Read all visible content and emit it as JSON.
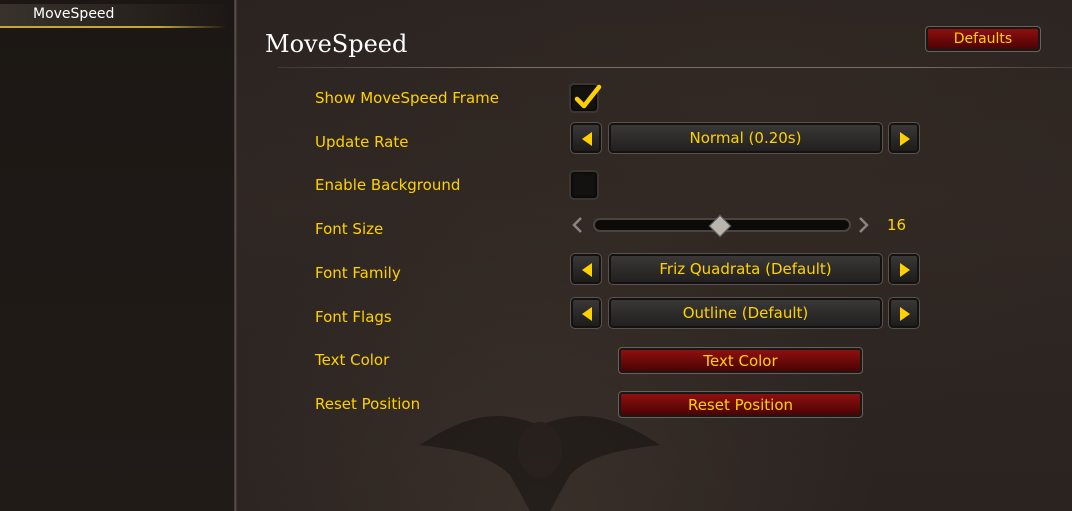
{
  "sidebar": {
    "items": [
      {
        "label": "MoveSpeed",
        "selected": true
      }
    ]
  },
  "header": {
    "title": "MoveSpeed",
    "defaults_label": "Defaults"
  },
  "settings": {
    "show_frame": {
      "label": "Show MoveSpeed Frame",
      "checked": true
    },
    "update_rate": {
      "label": "Update Rate",
      "value": "Normal (0.20s)"
    },
    "enable_background": {
      "label": "Enable Background",
      "checked": false
    },
    "font_size": {
      "label": "Font Size",
      "value": "16",
      "slider_fraction": 0.49
    },
    "font_family": {
      "label": "Font Family",
      "value": "Friz Quadrata (Default)"
    },
    "font_flags": {
      "label": "Font Flags",
      "value": "Outline (Default)"
    },
    "text_color": {
      "label": "Text Color",
      "button_label": "Text Color"
    },
    "reset_position": {
      "label": "Reset Position",
      "button_label": "Reset Position"
    }
  },
  "colors": {
    "accent_gold": "#ffd100",
    "button_red": "#7a0a0a",
    "background": "#2a2320"
  },
  "icons": {
    "checkmark": "check-icon",
    "left": "arrow-left-icon",
    "right": "arrow-right-icon"
  }
}
